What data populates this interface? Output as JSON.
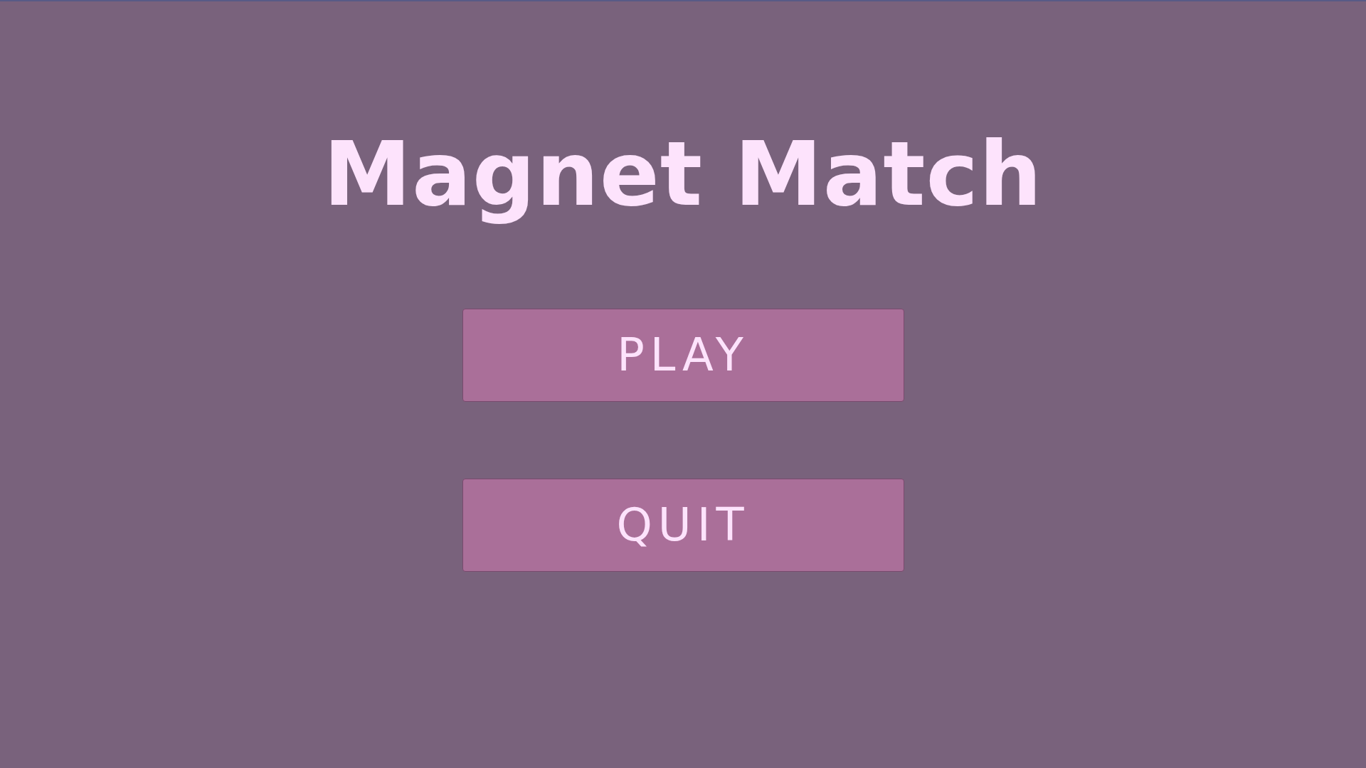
{
  "title": "Magnet Match",
  "buttons": [
    {
      "label": "PLAY"
    },
    {
      "label": "QUIT"
    }
  ]
}
